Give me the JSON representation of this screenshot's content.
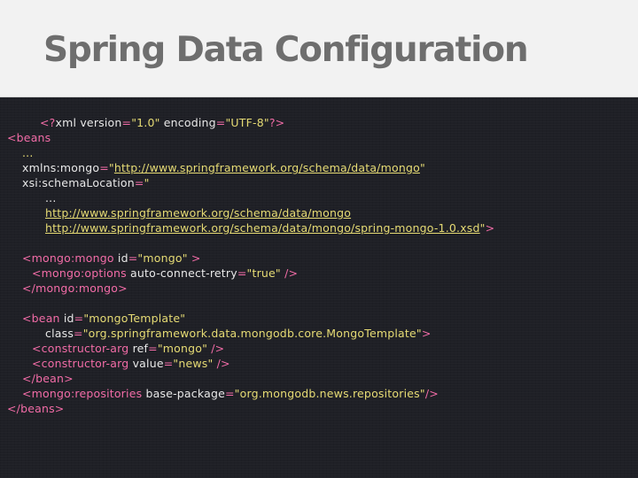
{
  "slide": {
    "title": "Spring Data Configuration"
  },
  "code": {
    "xml_decl_open": "<?",
    "xml_decl_name": "xml version",
    "xml_decl_eq1": "=",
    "xml_decl_version": "\"1.0\"",
    "xml_decl_encoding": " encoding",
    "xml_decl_eq2": "=",
    "xml_decl_encoding_value": "\"UTF-8\"",
    "xml_decl_close": "?>",
    "beans_open": "<beans",
    "ellipsis1": "...",
    "xmlns_attr": "xmlns:mongo",
    "eq": "=",
    "quote": "\"",
    "xmlns_url": "http://www.springframework.org/schema/data/mongo",
    "schema_attr": "xsi:schemaLocation",
    "ellipsis2": "...",
    "schema_url1": "http://www.springframework.org/schema/data/mongo",
    "schema_url2": "http://www.springframework.org/schema/data/mongo/spring-mongo-1.0.xsd",
    "beans_open_close": ">",
    "mongo_open": "<mongo:mongo",
    "mongo_id_attr": " id",
    "mongo_id_value": "\"mongo\"",
    "mongo_open_end": " >",
    "options_open": "<mongo:options",
    "options_attr": " auto-connect-retry",
    "options_value": "\"true\"",
    "options_end": " />",
    "mongo_close": "</mongo:mongo>",
    "bean_open": "<bean",
    "bean_id_attr": " id",
    "bean_id_value": "\"mongoTemplate\"",
    "bean_class_attr": "class",
    "bean_class_value": "\"org.springframework.data.mongodb.core.MongoTemplate\"",
    "bean_class_end": ">",
    "ctor1_open": "<constructor-arg",
    "ctor1_attr": " ref",
    "ctor1_value": "\"mongo\"",
    "ctor_end": " />",
    "ctor2_open": "<constructor-arg",
    "ctor2_attr": " value",
    "ctor2_value": "\"news\"",
    "bean_close": "</bean>",
    "repos_open": "<mongo:repositories",
    "repos_attr": " base-package",
    "repos_value": "\"org.mongodb.news.repositories\"",
    "repos_end": "/>",
    "beans_close": "</beans>"
  },
  "colors": {
    "tag": "#f26ca7",
    "string": "#e6db74",
    "text": "#e8e8e8",
    "background": "#1f2026",
    "header_bg": "#f2f2f2",
    "title": "#6e6e6e"
  }
}
